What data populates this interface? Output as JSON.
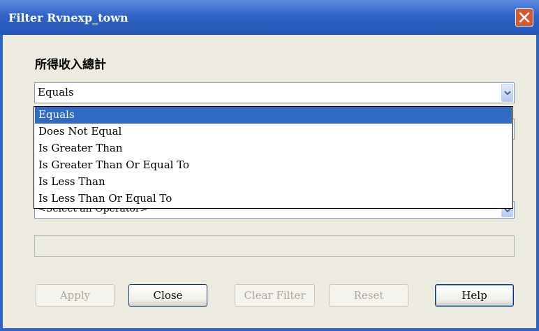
{
  "window": {
    "title": "Filter Rvnexp_town"
  },
  "field": {
    "label": "所得收入總計"
  },
  "operator_combo": {
    "value": "Equals",
    "options": [
      "Equals",
      "Does Not Equal",
      "Is Greater Than",
      "Is Greater Than Or Equal To",
      "Is Less Than",
      "Is Less Than Or Equal To"
    ],
    "selected_index": 0
  },
  "second_operator_combo": {
    "value": "<Select an Operator>"
  },
  "buttons": {
    "apply": "Apply",
    "close": "Close",
    "clear_filter": "Clear Filter",
    "reset": "Reset",
    "help": "Help"
  },
  "colors": {
    "titlebar": "#2f63c4",
    "client_bg": "#edeae0",
    "selection": "#316ac5",
    "close_button": "#d9562e"
  }
}
